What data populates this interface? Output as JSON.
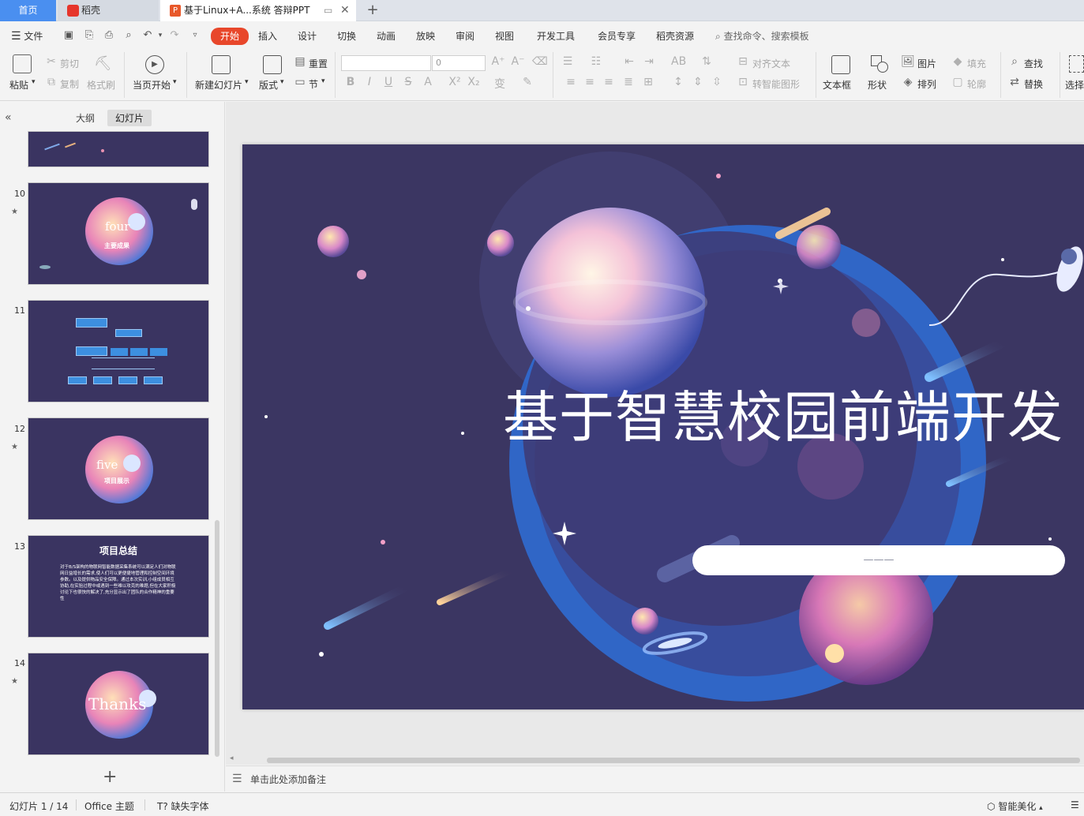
{
  "tabs": {
    "home": "首页",
    "docer": "稻壳",
    "document": "基于Linux+A...系统  答辩PPT",
    "document_icon": "P"
  },
  "menu": {
    "file": "文件",
    "items": [
      "开始",
      "插入",
      "设计",
      "切换",
      "动画",
      "放映",
      "审阅",
      "视图",
      "开发工具",
      "会员专享",
      "稻壳资源"
    ],
    "search": "查找命令、搜索模板"
  },
  "ribbon": {
    "paste": "粘贴",
    "cut": "剪切",
    "copy": "复制",
    "format_painter": "格式刷",
    "play_current": "当页开始",
    "new_slide": "新建幻灯片",
    "layout": "版式",
    "reset": "重置",
    "section": "节",
    "font_size": "0",
    "align_text": "对齐文本",
    "smart_shape": "转智能图形",
    "textbox": "文本框",
    "shape": "形状",
    "picture": "图片",
    "arrange": "排列",
    "fill": "填充",
    "outline": "轮廓",
    "find": "查找",
    "replace": "替换",
    "select": "选择"
  },
  "panel": {
    "outline": "大纲",
    "slides": "幻灯片",
    "thumbnails": [
      {
        "number": "10",
        "caption": "four",
        "subcaption": "主要成果"
      },
      {
        "number": "11",
        "caption": ""
      },
      {
        "number": "12",
        "caption": "five",
        "subcaption": "项目展示"
      },
      {
        "number": "13",
        "caption": "项目总结",
        "body": "对于B/S架构的物联网智能数据采集系统可以满足人们对物联网日益增长的需求,使人们可以更便捷地管理和控制空间环境参数。以及提供物品安全保障。通过本次实训,小组成员相互协助,在实验过程中或遇到一些难以攻克的难题,但在大家积极讨论下也很快的解决了,充分显示出了团队的合作精神的重要性"
      },
      {
        "number": "14",
        "caption": "Thanks"
      }
    ]
  },
  "slide": {
    "title": "基于智慧校园前端开发",
    "subtitle": "———"
  },
  "notes": {
    "placeholder": "单击此处添加备注"
  },
  "status": {
    "slide_counter": "幻灯片 1 / 14",
    "theme": "Office 主题",
    "missing_font": "缺失字体",
    "beautify": "智能美化"
  }
}
